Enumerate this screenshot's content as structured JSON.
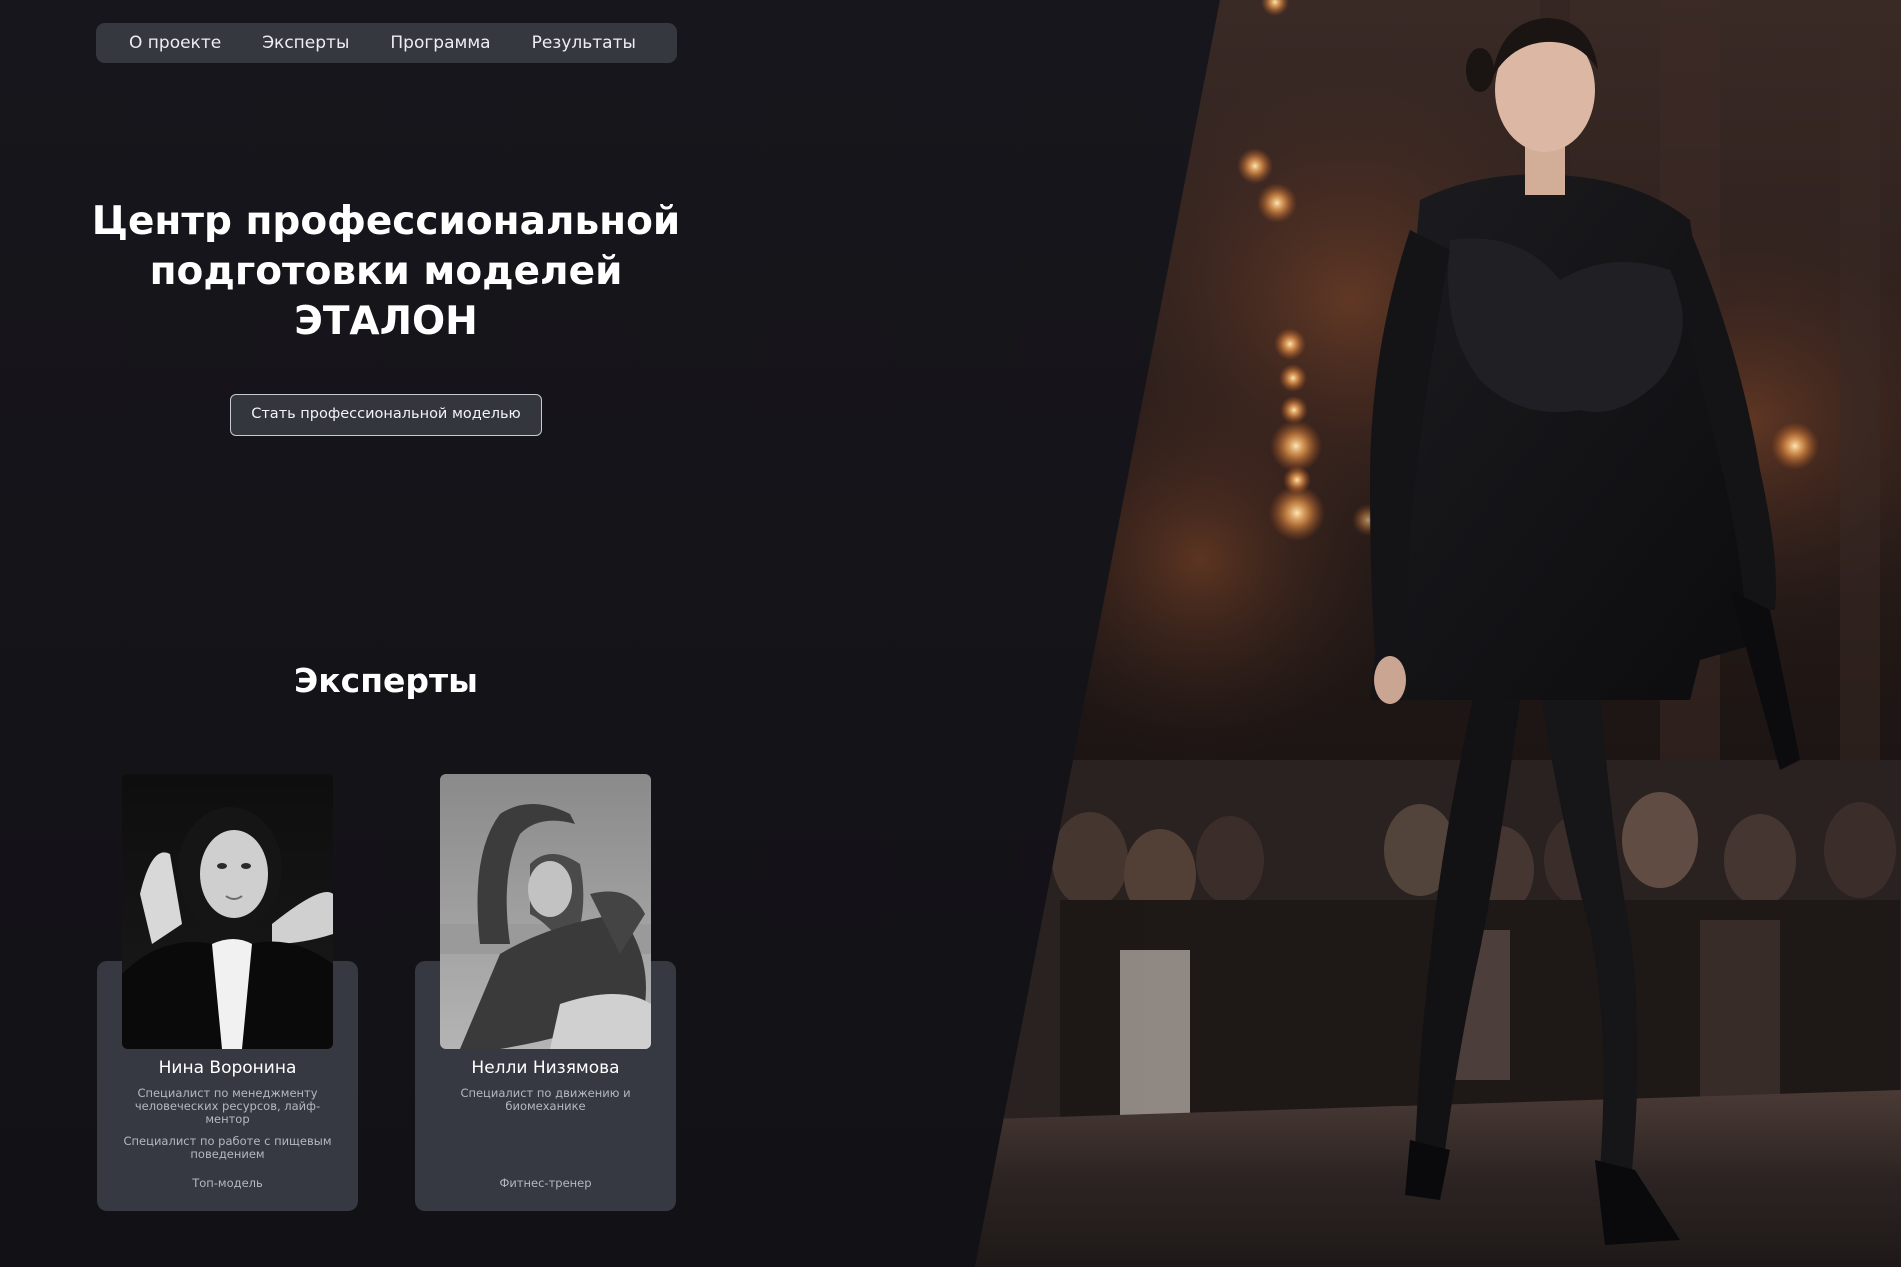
{
  "nav": {
    "items": [
      "О проекте",
      "Эксперты",
      "Программа",
      "Результаты"
    ]
  },
  "hero": {
    "title_lines": [
      "Центр профессиональной",
      "подготовки моделей",
      "ЭТАЛОН"
    ],
    "cta_label": "Стать профессиональной моделью"
  },
  "experts": {
    "title": "Эксперты",
    "cards": [
      {
        "name": "Нина Воронина",
        "desc1": "Специалист по менеджменту человеческих ресурсов, лайф-ментор",
        "desc2": "Специалист по работе с пищевым поведением",
        "role": "Топ-модель"
      },
      {
        "name": "Нелли Низямова",
        "desc1": "Специалист по движению и биомеханике",
        "role": "Фитнес-тренер"
      }
    ]
  }
}
